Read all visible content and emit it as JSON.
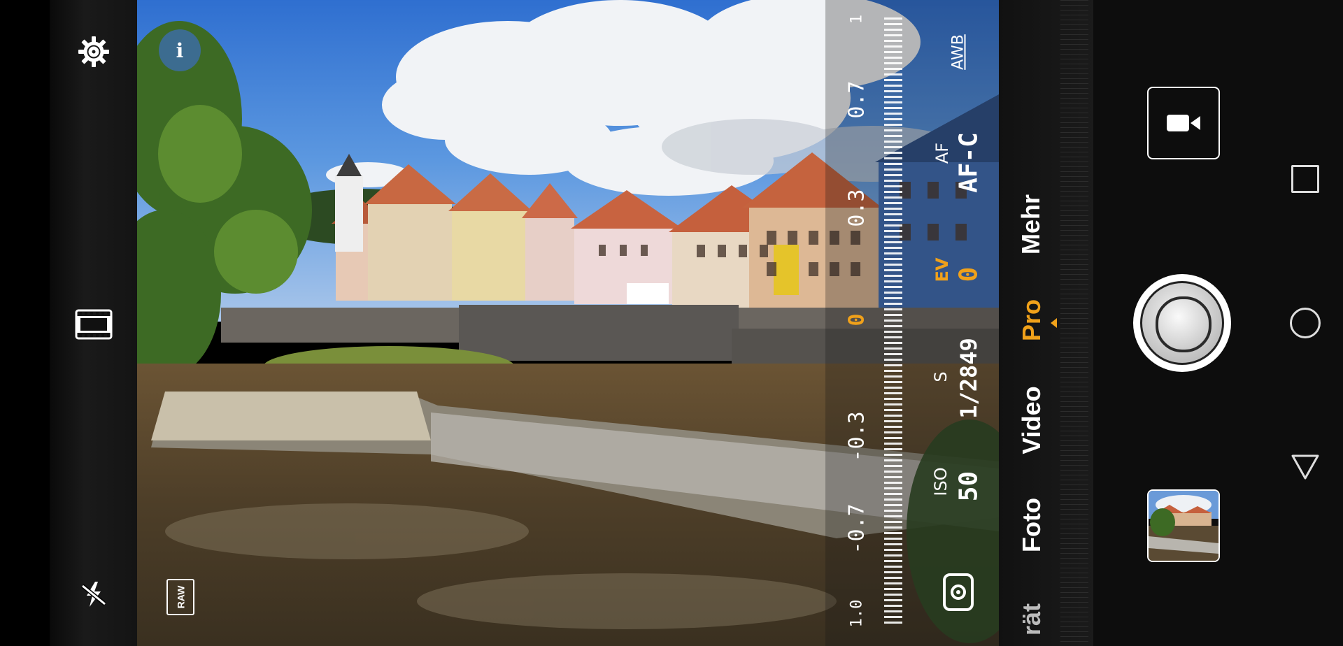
{
  "colors": {
    "accent": "#f0a11a",
    "bar_bg": "#0d0d0d"
  },
  "left_toolbar": {
    "settings_icon": "gear-icon",
    "video_mode_icon": "film-icon",
    "flash_icon": "flash-off-icon",
    "raw_label": "RAW"
  },
  "info_icon": "i",
  "ev_scale": {
    "labels": [
      "1.0",
      "-0.7",
      "-0.3",
      "0",
      "0.3",
      "0.7",
      "1"
    ],
    "current": "0"
  },
  "params": {
    "iso": {
      "label": "ISO",
      "value": "50"
    },
    "shutter": {
      "label": "S",
      "value": "1/2849"
    },
    "ev": {
      "label": "EV",
      "value": "0"
    },
    "af": {
      "label": "AF",
      "value": "AF-C"
    },
    "wb": {
      "label": "AWB"
    }
  },
  "modes": [
    "rät",
    "Foto",
    "Video",
    "Pro",
    "Mehr"
  ],
  "active_mode": "Pro"
}
